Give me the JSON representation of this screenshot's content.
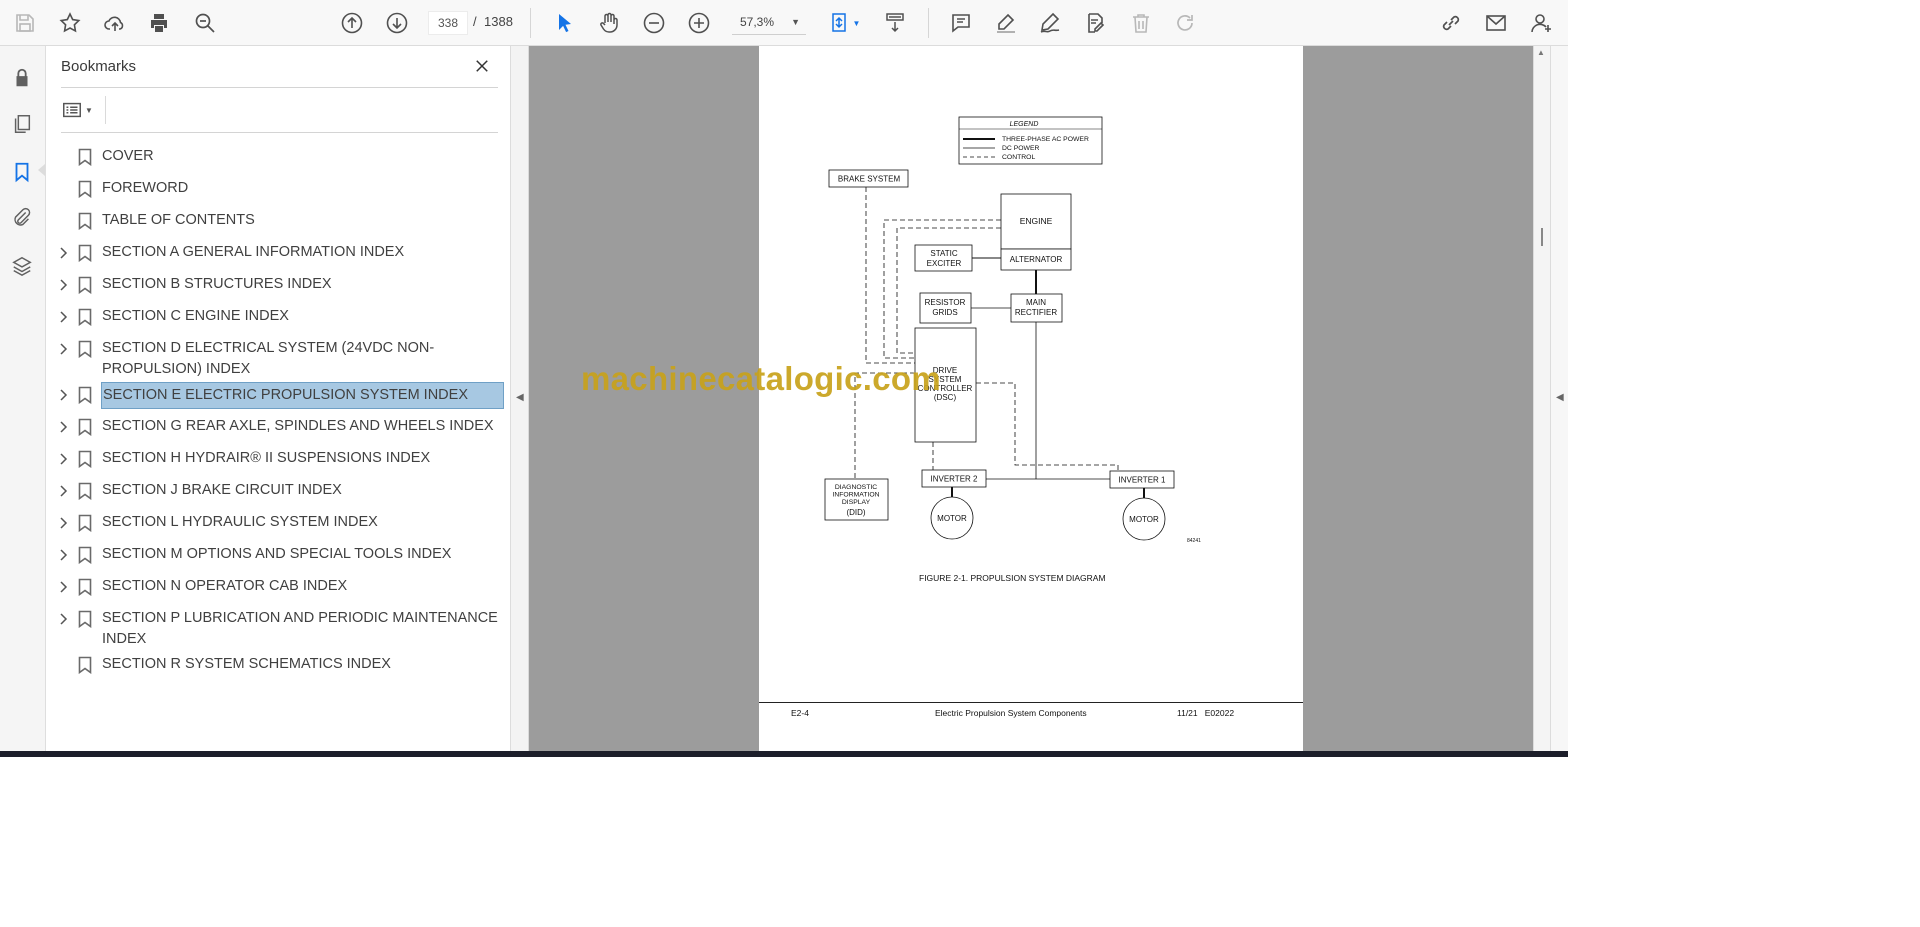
{
  "toolbar": {
    "current_page": "338",
    "page_separator": "/",
    "total_pages": "1388",
    "zoom": "57,3%"
  },
  "bookmarks_panel": {
    "title": "Bookmarks",
    "items": [
      {
        "label": "COVER",
        "expandable": false
      },
      {
        "label": "FOREWORD",
        "expandable": false
      },
      {
        "label": "TABLE OF CONTENTS",
        "expandable": false
      },
      {
        "label": "SECTION A GENERAL INFORMATION INDEX",
        "expandable": true
      },
      {
        "label": "SECTION B STRUCTURES INDEX",
        "expandable": true
      },
      {
        "label": "SECTION C ENGINE INDEX",
        "expandable": true
      },
      {
        "label": "SECTION D ELECTRICAL SYSTEM (24VDC NON-PROPULSION) INDEX",
        "expandable": true
      },
      {
        "label": "SECTION E ELECTRIC PROPULSION SYSTEM INDEX",
        "expandable": true,
        "selected": true
      },
      {
        "label": "SECTION G REAR AXLE, SPINDLES AND WHEELS INDEX",
        "expandable": true
      },
      {
        "label": "SECTION H HYDRAIR® II SUSPENSIONS INDEX",
        "expandable": true
      },
      {
        "label": "SECTION J BRAKE CIRCUIT INDEX",
        "expandable": true
      },
      {
        "label": "SECTION L HYDRAULIC SYSTEM INDEX",
        "expandable": true
      },
      {
        "label": "SECTION M OPTIONS AND SPECIAL TOOLS INDEX",
        "expandable": true
      },
      {
        "label": "SECTION N OPERATOR CAB INDEX",
        "expandable": true
      },
      {
        "label": "SECTION P LUBRICATION AND PERIODIC MAINTENANCE INDEX",
        "expandable": true
      },
      {
        "label": "SECTION R SYSTEM SCHEMATICS INDEX",
        "expandable": false
      }
    ]
  },
  "document": {
    "legend": {
      "title": "LEGEND",
      "entries": [
        "THREE-PHASE AC POWER",
        "DC POWER",
        "CONTROL"
      ]
    },
    "diagram": {
      "brake_system": "BRAKE SYSTEM",
      "engine": "ENGINE",
      "alternator": "ALTERNATOR",
      "static_exciter_1": "STATIC",
      "static_exciter_2": "EXCITER",
      "resistor_grids_1": "RESISTOR",
      "resistor_grids_2": "GRIDS",
      "main_rectifier_1": "MAIN",
      "main_rectifier_2": "RECTIFIER",
      "dsc_1": "DRIVE",
      "dsc_2": "SYSTEM",
      "dsc_3": "CONTROLLER",
      "dsc_4": "(DSC)",
      "did_1": "DIAGNOSTIC",
      "did_2": "INFORMATION",
      "did_3": "DISPLAY",
      "did_4": "(DID)",
      "inverter_2": "INVERTER 2",
      "inverter_1": "INVERTER 1",
      "motor_left": "MOTOR",
      "motor_right": "MOTOR",
      "figure_number": "84241"
    },
    "figure_caption": "FIGURE 2-1. PROPULSION SYSTEM DIAGRAM",
    "footer": {
      "page_ref": "E2-4",
      "title": "Electric Propulsion System Components",
      "date": "11/21",
      "code": "E02022"
    },
    "watermark": "machinecatalogic.com"
  }
}
